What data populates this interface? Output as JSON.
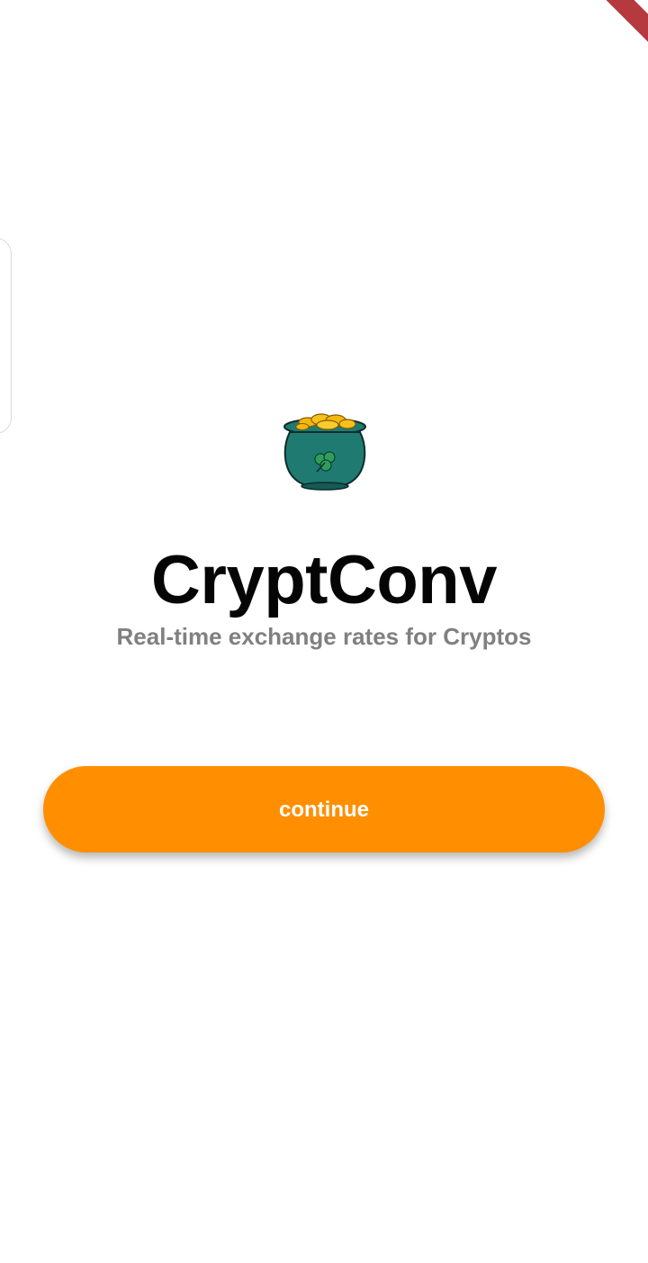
{
  "app": {
    "title": "CryptConv",
    "subtitle": "Real-time exchange rates for Cryptos"
  },
  "logo": {
    "icon": "pot-of-gold-icon"
  },
  "actions": {
    "continue_label": "continue"
  },
  "colors": {
    "accent": "#ff8f00",
    "title": "#050505",
    "subtitle": "#808080",
    "debug_banner": "#b5393f",
    "pot": "#1f7a72",
    "gold": "#f2b90c",
    "shamrock": "#2e9e5a"
  }
}
